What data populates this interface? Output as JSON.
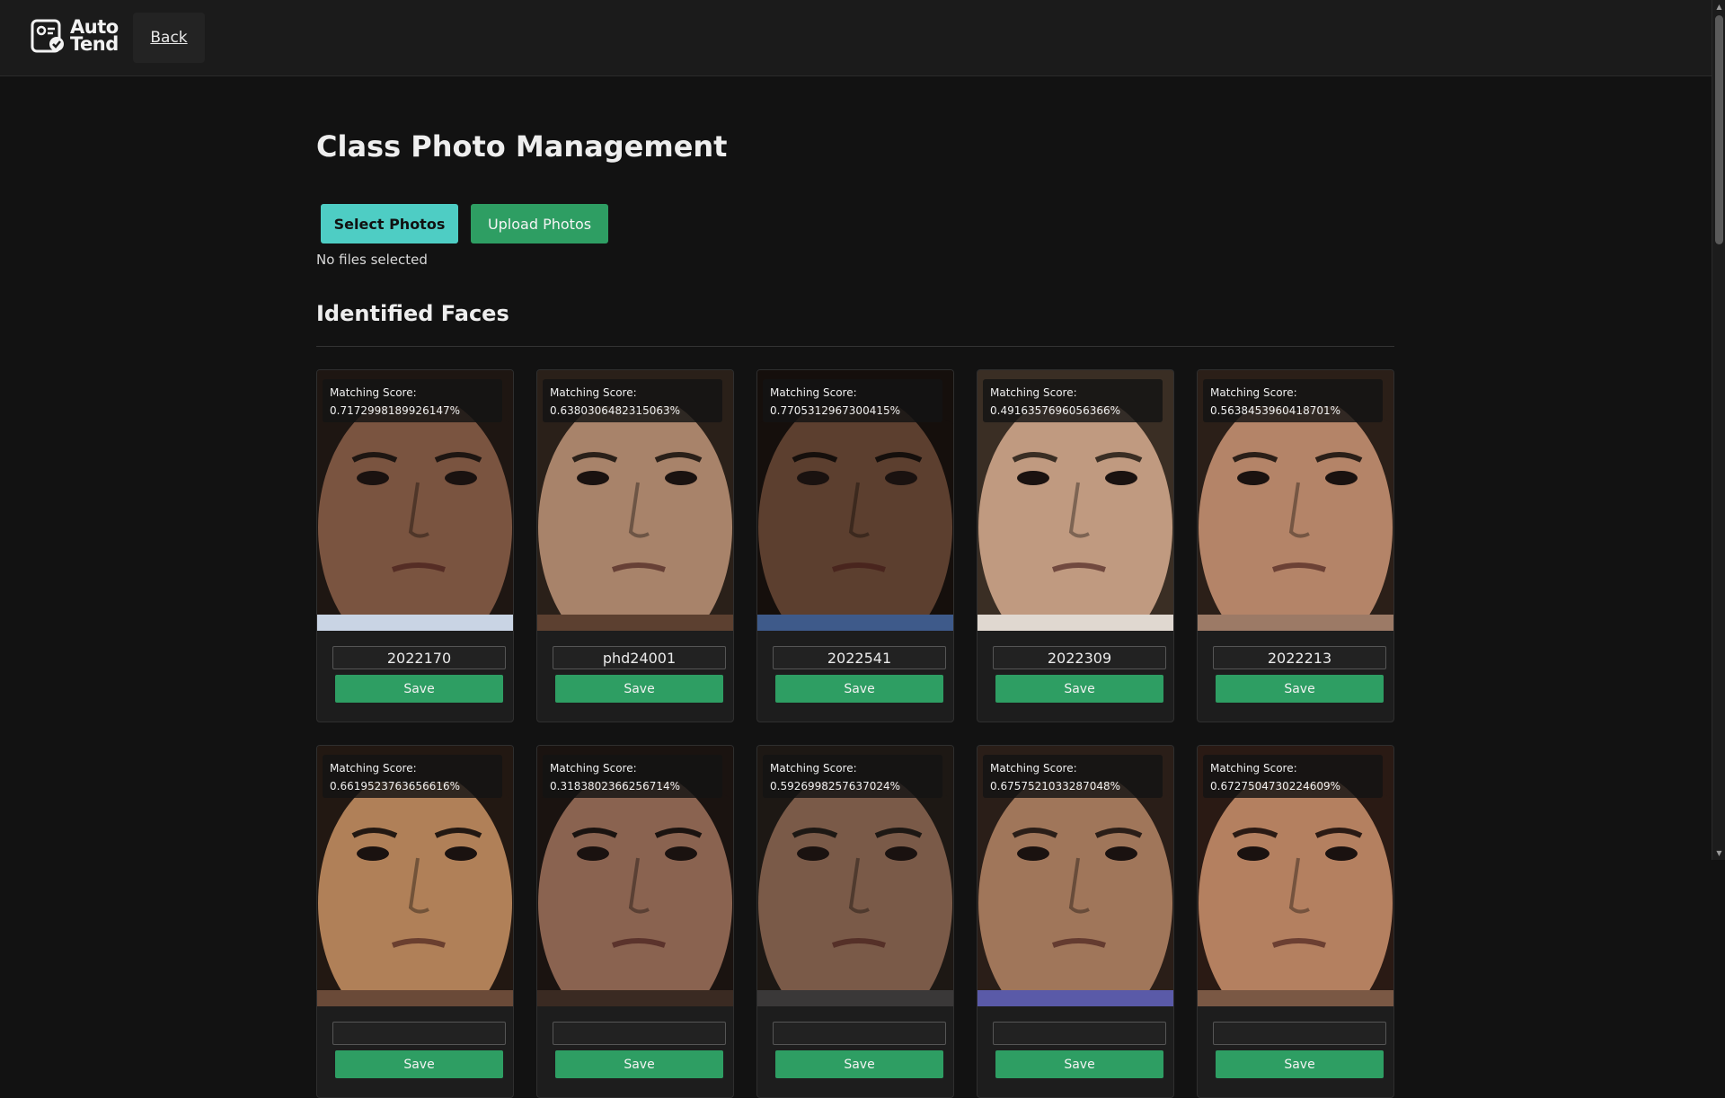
{
  "brand": {
    "line1": "Auto",
    "line2": "Tend",
    "accent": "#4ecdc4"
  },
  "nav": {
    "back_label": "Back"
  },
  "page": {
    "title": "Class Photo Management",
    "select_label": "Select Photos",
    "upload_label": "Upload Photos",
    "files_status": "No files selected",
    "section_title": "Identified Faces",
    "score_label": "Matching Score:",
    "save_label": "Save"
  },
  "colors": {
    "background": "#121212",
    "select_button": "#4ecdc4",
    "upload_button": "#2e9e63",
    "save_button": "#2e9e63"
  },
  "faces": [
    {
      "score": "0.7172998189926147%",
      "student_id": "2022170",
      "skin": "#7a5440",
      "hair": "#1e1612",
      "shirt": "#c9d4e4"
    },
    {
      "score": "0.6380306482315063%",
      "student_id": "phd24001",
      "skin": "#a8836a",
      "hair": "#2a2019",
      "shirt": "#5c4030"
    },
    {
      "score": "0.7705312967300415%",
      "student_id": "2022541",
      "skin": "#5c3f2f",
      "hair": "#150f0c",
      "shirt": "#3e5a8a"
    },
    {
      "score": "0.4916357696056366%",
      "student_id": "2022309",
      "skin": "#c09a80",
      "hair": "#3a2e24",
      "shirt": "#e0d8d0"
    },
    {
      "score": "0.5638453960418701%",
      "student_id": "2022213",
      "skin": "#b48468",
      "hair": "#2b1f18",
      "shirt": "#9c7a66"
    },
    {
      "score": "0.6619523763656616%",
      "student_id": "",
      "skin": "#b08058",
      "hair": "#221812",
      "shirt": "#6a4a38"
    },
    {
      "score": "0.3183802366256714%",
      "student_id": "",
      "skin": "#8a6350",
      "hair": "#1a1310",
      "shirt": "#3a2a22"
    },
    {
      "score": "0.5926998257637024%",
      "student_id": "",
      "skin": "#7a5a48",
      "hair": "#1d1814",
      "shirt": "#3a3838"
    },
    {
      "score": "0.6757521033287048%",
      "student_id": "",
      "skin": "#a0765a",
      "hair": "#2a1e18",
      "shirt": "#5a5aa8"
    },
    {
      "score": "0.6727504730224609%",
      "student_id": "",
      "skin": "#b48060",
      "hair": "#2a1a14",
      "shirt": "#7a5844"
    }
  ]
}
